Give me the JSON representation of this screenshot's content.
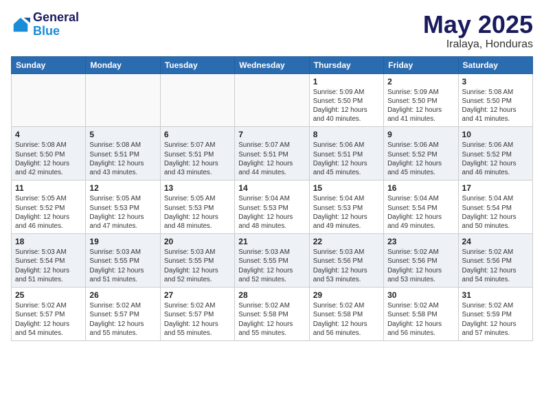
{
  "header": {
    "logo_line1": "General",
    "logo_line2": "Blue",
    "month_title": "May 2025",
    "location": "Iralaya, Honduras"
  },
  "weekdays": [
    "Sunday",
    "Monday",
    "Tuesday",
    "Wednesday",
    "Thursday",
    "Friday",
    "Saturday"
  ],
  "weeks": [
    [
      {
        "day": "",
        "info": ""
      },
      {
        "day": "",
        "info": ""
      },
      {
        "day": "",
        "info": ""
      },
      {
        "day": "",
        "info": ""
      },
      {
        "day": "1",
        "info": "Sunrise: 5:09 AM\nSunset: 5:50 PM\nDaylight: 12 hours\nand 40 minutes."
      },
      {
        "day": "2",
        "info": "Sunrise: 5:09 AM\nSunset: 5:50 PM\nDaylight: 12 hours\nand 41 minutes."
      },
      {
        "day": "3",
        "info": "Sunrise: 5:08 AM\nSunset: 5:50 PM\nDaylight: 12 hours\nand 41 minutes."
      }
    ],
    [
      {
        "day": "4",
        "info": "Sunrise: 5:08 AM\nSunset: 5:50 PM\nDaylight: 12 hours\nand 42 minutes."
      },
      {
        "day": "5",
        "info": "Sunrise: 5:08 AM\nSunset: 5:51 PM\nDaylight: 12 hours\nand 43 minutes."
      },
      {
        "day": "6",
        "info": "Sunrise: 5:07 AM\nSunset: 5:51 PM\nDaylight: 12 hours\nand 43 minutes."
      },
      {
        "day": "7",
        "info": "Sunrise: 5:07 AM\nSunset: 5:51 PM\nDaylight: 12 hours\nand 44 minutes."
      },
      {
        "day": "8",
        "info": "Sunrise: 5:06 AM\nSunset: 5:51 PM\nDaylight: 12 hours\nand 45 minutes."
      },
      {
        "day": "9",
        "info": "Sunrise: 5:06 AM\nSunset: 5:52 PM\nDaylight: 12 hours\nand 45 minutes."
      },
      {
        "day": "10",
        "info": "Sunrise: 5:06 AM\nSunset: 5:52 PM\nDaylight: 12 hours\nand 46 minutes."
      }
    ],
    [
      {
        "day": "11",
        "info": "Sunrise: 5:05 AM\nSunset: 5:52 PM\nDaylight: 12 hours\nand 46 minutes."
      },
      {
        "day": "12",
        "info": "Sunrise: 5:05 AM\nSunset: 5:53 PM\nDaylight: 12 hours\nand 47 minutes."
      },
      {
        "day": "13",
        "info": "Sunrise: 5:05 AM\nSunset: 5:53 PM\nDaylight: 12 hours\nand 48 minutes."
      },
      {
        "day": "14",
        "info": "Sunrise: 5:04 AM\nSunset: 5:53 PM\nDaylight: 12 hours\nand 48 minutes."
      },
      {
        "day": "15",
        "info": "Sunrise: 5:04 AM\nSunset: 5:53 PM\nDaylight: 12 hours\nand 49 minutes."
      },
      {
        "day": "16",
        "info": "Sunrise: 5:04 AM\nSunset: 5:54 PM\nDaylight: 12 hours\nand 49 minutes."
      },
      {
        "day": "17",
        "info": "Sunrise: 5:04 AM\nSunset: 5:54 PM\nDaylight: 12 hours\nand 50 minutes."
      }
    ],
    [
      {
        "day": "18",
        "info": "Sunrise: 5:03 AM\nSunset: 5:54 PM\nDaylight: 12 hours\nand 51 minutes."
      },
      {
        "day": "19",
        "info": "Sunrise: 5:03 AM\nSunset: 5:55 PM\nDaylight: 12 hours\nand 51 minutes."
      },
      {
        "day": "20",
        "info": "Sunrise: 5:03 AM\nSunset: 5:55 PM\nDaylight: 12 hours\nand 52 minutes."
      },
      {
        "day": "21",
        "info": "Sunrise: 5:03 AM\nSunset: 5:55 PM\nDaylight: 12 hours\nand 52 minutes."
      },
      {
        "day": "22",
        "info": "Sunrise: 5:03 AM\nSunset: 5:56 PM\nDaylight: 12 hours\nand 53 minutes."
      },
      {
        "day": "23",
        "info": "Sunrise: 5:02 AM\nSunset: 5:56 PM\nDaylight: 12 hours\nand 53 minutes."
      },
      {
        "day": "24",
        "info": "Sunrise: 5:02 AM\nSunset: 5:56 PM\nDaylight: 12 hours\nand 54 minutes."
      }
    ],
    [
      {
        "day": "25",
        "info": "Sunrise: 5:02 AM\nSunset: 5:57 PM\nDaylight: 12 hours\nand 54 minutes."
      },
      {
        "day": "26",
        "info": "Sunrise: 5:02 AM\nSunset: 5:57 PM\nDaylight: 12 hours\nand 55 minutes."
      },
      {
        "day": "27",
        "info": "Sunrise: 5:02 AM\nSunset: 5:57 PM\nDaylight: 12 hours\nand 55 minutes."
      },
      {
        "day": "28",
        "info": "Sunrise: 5:02 AM\nSunset: 5:58 PM\nDaylight: 12 hours\nand 55 minutes."
      },
      {
        "day": "29",
        "info": "Sunrise: 5:02 AM\nSunset: 5:58 PM\nDaylight: 12 hours\nand 56 minutes."
      },
      {
        "day": "30",
        "info": "Sunrise: 5:02 AM\nSunset: 5:58 PM\nDaylight: 12 hours\nand 56 minutes."
      },
      {
        "day": "31",
        "info": "Sunrise: 5:02 AM\nSunset: 5:59 PM\nDaylight: 12 hours\nand 57 minutes."
      }
    ]
  ]
}
